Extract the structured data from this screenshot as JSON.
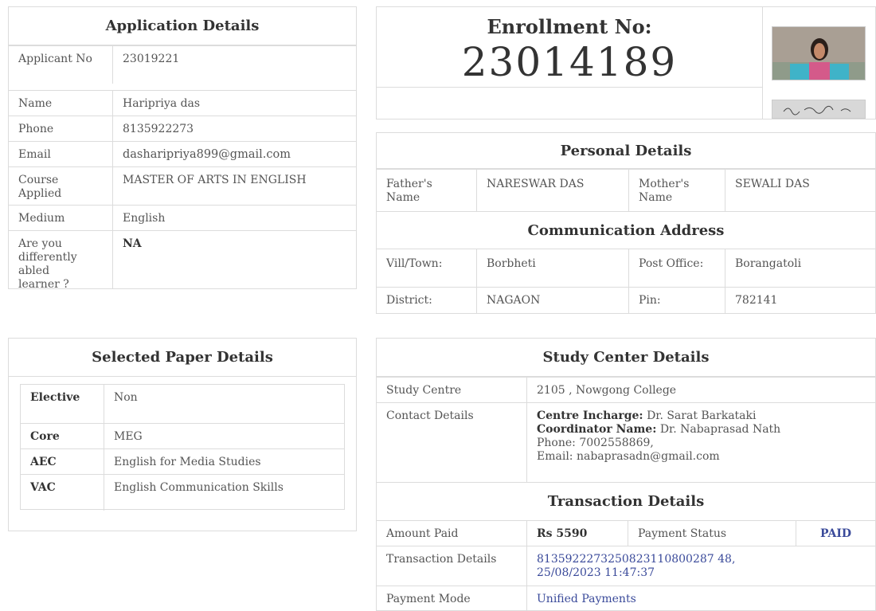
{
  "application": {
    "title": "Application Details",
    "rows": [
      {
        "label": "Applicant No",
        "value": "23019221"
      },
      {
        "label": "Name",
        "value": "Haripriya das"
      },
      {
        "label": "Phone",
        "value": "8135922273"
      },
      {
        "label": "Email",
        "value": "dasharipriya899@gmail.com"
      },
      {
        "label": "Course Applied",
        "value": "MASTER OF ARTS IN ENGLISH"
      },
      {
        "label": "Medium",
        "value": "English"
      },
      {
        "label": "Are you differently abled learner ?",
        "value": "NA"
      }
    ]
  },
  "enrollment": {
    "title": "Enrollment No:",
    "number": "23014189"
  },
  "personal": {
    "title": "Personal Details",
    "father_label": "Father's Name",
    "father_value": "NARESWAR DAS",
    "mother_label": "Mother's Name",
    "mother_value": "SEWALI DAS",
    "address_title": "Communication Address",
    "vill_label": "Vill/Town:",
    "vill_value": "Borbheti",
    "post_label": "Post Office:",
    "post_value": "Borangatoli",
    "district_label": "District:",
    "district_value": "NAGAON",
    "pin_label": "Pin:",
    "pin_value": "782141"
  },
  "paper": {
    "title": "Selected Paper Details",
    "rows": [
      {
        "label": "Elective",
        "value": "Non"
      },
      {
        "label": "Core",
        "value": "MEG"
      },
      {
        "label": "AEC",
        "value": "English for Media Studies"
      },
      {
        "label": "VAC",
        "value": "English Communication Skills"
      }
    ]
  },
  "study": {
    "title": "Study Center Details",
    "centre_label": "Study Centre",
    "centre_value": "2105 , Nowgong College",
    "contact_label": "Contact Details",
    "incharge_label": "Centre Incharge:",
    "incharge_value": "Dr. Sarat Barkataki",
    "coordinator_label": "Coordinator Name:",
    "coordinator_value": "Dr. Nabaprasad Nath",
    "phone_line": "Phone: 7002558869,",
    "email_line": "Email: nabaprasadn@gmail.com"
  },
  "transaction": {
    "title": "Transaction Details",
    "amount_label": "Amount Paid",
    "amount_value": "Rs 5590",
    "status_label": "Payment Status",
    "status_value": "PAID",
    "details_label": "Transaction Details",
    "details_value": "8135922273250823110800287 48, 25/08/2023 11:47:37",
    "mode_label": "Payment Mode",
    "mode_value": "Unified Payments"
  }
}
